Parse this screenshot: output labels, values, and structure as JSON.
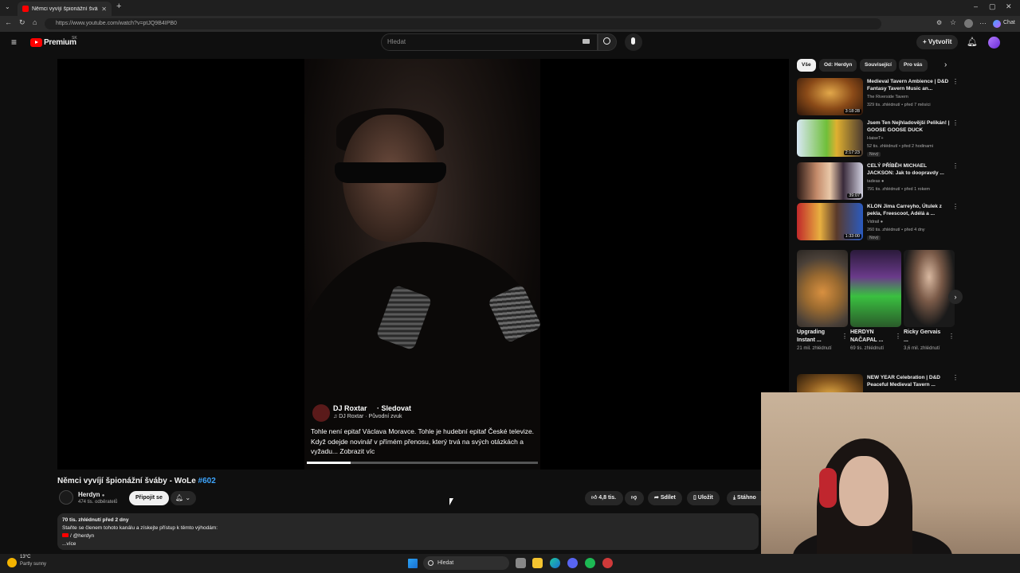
{
  "browser": {
    "tab_title": "Němci vyvíjí špionážní šváby - W",
    "url": "https://www.youtube.com/watch?v=ptJQ9B4IPB0",
    "chat_label": "Chat"
  },
  "header": {
    "logo_text": "Premium",
    "logo_country": "SK",
    "search_placeholder": "Hledat",
    "create_label": "Vytvořit"
  },
  "player": {
    "overlay_channel": "DJ Roxtar",
    "overlay_follow": "· Sledovat",
    "overlay_sound": "♫ DJ Roxtar · Původní zvuk",
    "overlay_caption": "Tohle není epitaf Václava Moravce. Tohle je hudební epitaf České televize. Když odejde novinář v přímém přenosu, který trvá na svých otázkách a vyžadu... Zobrazit víc",
    "overlay_progress": 0.19
  },
  "video": {
    "title": "Němci vyvíjí špionážní šváby - WoLe",
    "title_tag": "#602",
    "channel": "Herdyn",
    "subscribers": "474 tis. odběratelů",
    "join_label": "Připojit se",
    "likes": "4,8 tis.",
    "share_label": "Sdílet",
    "save_label": "Uložit",
    "download_label": "Stáhno",
    "desc_meta": "70 tis. zhlédnutí  před 2 dny",
    "desc_line1": "Staňte se členem tohoto kanálu a získejte přístup k těmto výhodám:",
    "desc_line2": "/ @herdyn",
    "desc_more": "...více"
  },
  "chips": [
    "Vše",
    "Od: Herdyn",
    "Související",
    "Pro vás"
  ],
  "recommendations": [
    {
      "title": "Medieval Tavern Ambience | D&D Fantasy Tavern Music an...",
      "channel": "The Riverside Tavern",
      "meta": "329 tis. zhlédnutí • před 7 měsíci",
      "duration": "3:18:28",
      "badge": ""
    },
    {
      "title": "Jsem Ten Nejhladovější Pelikán! | GOOSE GOOSE DUCK",
      "channel": "HaiseT+",
      "meta": "52 tis. zhlédnutí • před 2 hodinami",
      "duration": "2:17:23",
      "badge": "Nový"
    },
    {
      "title": "CELÝ PŘÍBĚH MICHAEL JACKSON: Jak to doopravdy ...",
      "channel": "tadeas",
      "meta": "791 tis. zhlédnutí • před 1 rokem",
      "duration": "39:07",
      "badge": ""
    },
    {
      "title": "KLON Jima Carreyho, Útulek z pekla, Freescoot, Adélá a ...",
      "channel": "Vidrail",
      "meta": "260 tis. zhlédnutí • před 4 dny",
      "duration": "1:33:00",
      "badge": "Nový"
    }
  ],
  "shorts": [
    {
      "title": "Upgrading Instant ...",
      "views": "21 mil. zhlédnutí"
    },
    {
      "title": "HERDYN NAČAPAL ...",
      "views": "69 tis. zhlédnutí"
    },
    {
      "title": "Ricky Gervais ...",
      "views": "3,6 mil. zhlédnutí"
    }
  ],
  "rec_bottom": {
    "title": "NEW YEAR Celebration | D&D Peaceful Medieval Tavern ..."
  },
  "taskbar": {
    "temp": "13°C",
    "weather": "Partly sunny",
    "search_label": "Hledat"
  },
  "colors": {
    "youtube_red": "#ff0000",
    "link_blue": "#3ea6ff",
    "bg": "#0f0f0f"
  }
}
